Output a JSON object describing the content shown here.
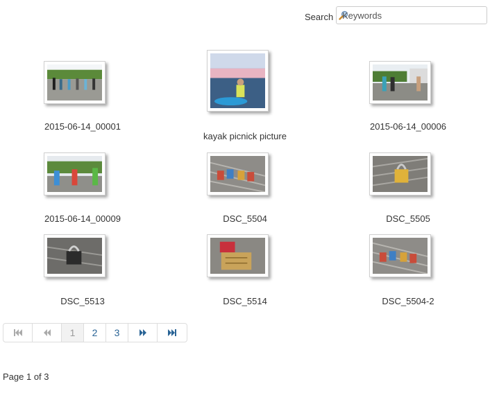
{
  "search": {
    "label": "Search",
    "placeholder": "Keywords",
    "value": ""
  },
  "gallery": {
    "items": [
      {
        "caption": "2015-06-14_00001"
      },
      {
        "caption": "kayak picnick picture"
      },
      {
        "caption": "2015-06-14_00006"
      },
      {
        "caption": "2015-06-14_00009"
      },
      {
        "caption": "DSC_5504"
      },
      {
        "caption": "DSC_5505"
      },
      {
        "caption": "DSC_5513"
      },
      {
        "caption": "DSC_5514"
      },
      {
        "caption": "DSC_5504-2"
      }
    ]
  },
  "pagination": {
    "pages": [
      "1",
      "2",
      "3"
    ],
    "current_page": "1",
    "first_icon": "first-page-icon",
    "prev_icon": "previous-page-icon",
    "next_icon": "next-page-icon",
    "last_icon": "last-page-icon",
    "status": "Page 1 of 3"
  }
}
